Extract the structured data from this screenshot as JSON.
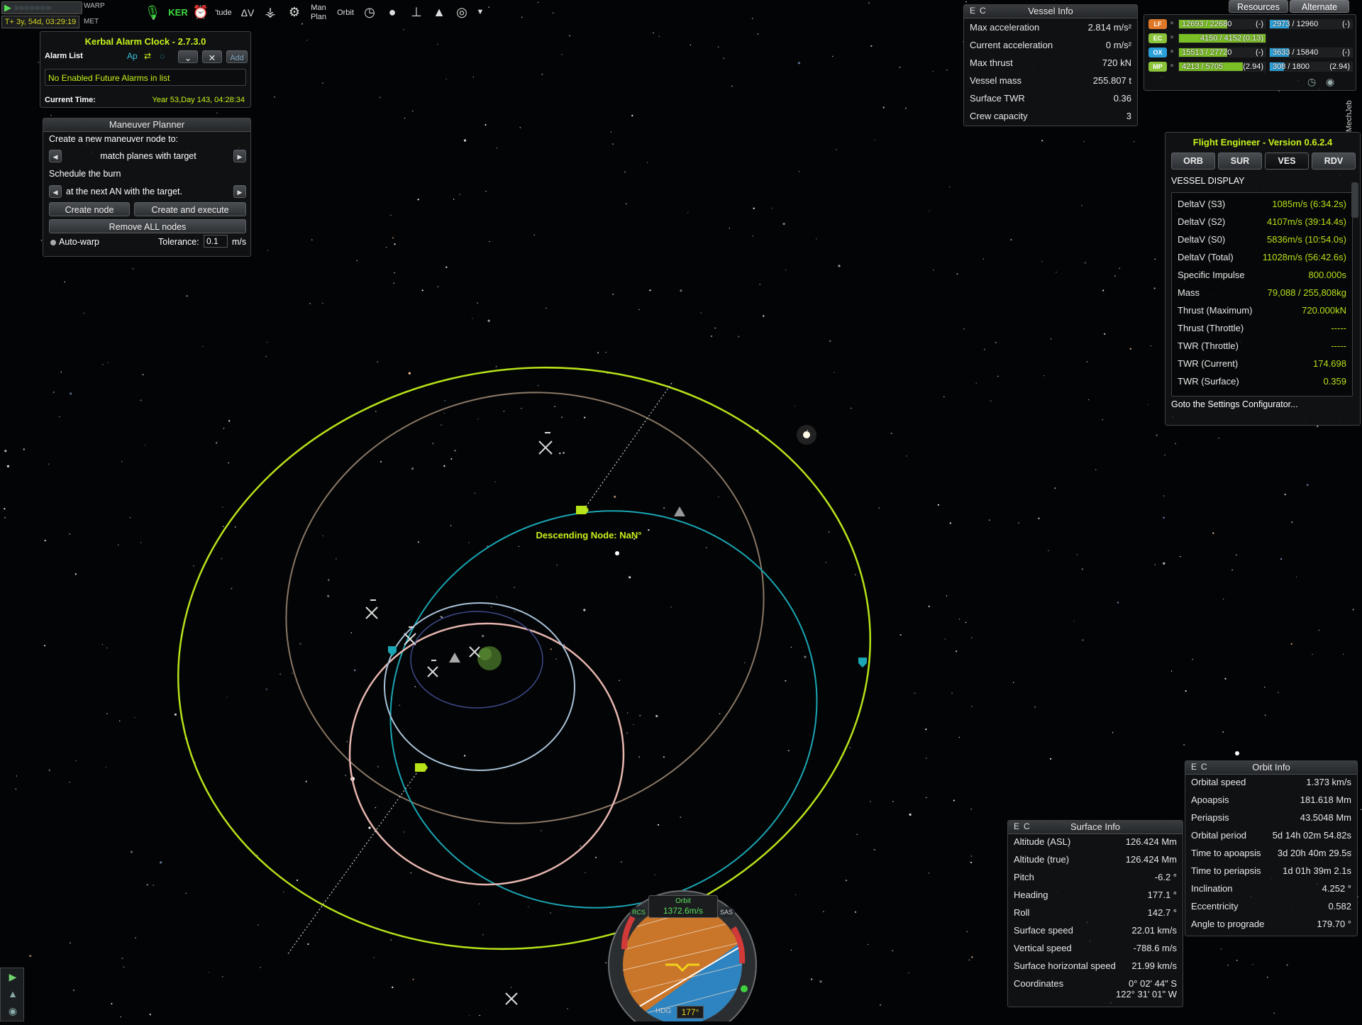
{
  "time": {
    "warp_label": "WARP",
    "met_time": "T+ 3y, 54d, 03:29:19",
    "met_label": "MET"
  },
  "toolbar": {
    "items": [
      {
        "label": "",
        "icon": "microphone-icon"
      },
      {
        "label": "KER",
        "icon": "ker-icon"
      },
      {
        "label": "",
        "icon": "alarm-clock-icon"
      },
      {
        "label": "'tude",
        "icon": "attitude-icon"
      },
      {
        "label": "ΔV",
        "icon": "delta-v-icon"
      },
      {
        "label": "",
        "icon": "lander-icon"
      },
      {
        "label": "",
        "icon": "settings-icon"
      },
      {
        "label": "Man\nPlan",
        "icon": "maneuver-planner-icon"
      },
      {
        "label": "Orbit",
        "icon": "orbit-icon"
      },
      {
        "label": "",
        "icon": "clock-icon"
      },
      {
        "label": "",
        "icon": "sphere-icon"
      },
      {
        "label": "",
        "icon": "antenna-icon"
      },
      {
        "label": "",
        "icon": "rocket-icon"
      },
      {
        "label": "",
        "icon": "target-icon"
      }
    ]
  },
  "alarm_clock": {
    "title": "Kerbal Alarm Clock - 2.7.3.0",
    "list_label": "Alarm List",
    "add_label": "Add",
    "empty_text": "No Enabled Future Alarms in list",
    "current_time_label": "Current Time:",
    "current_time": "Year 53,Day 143, 04:28:34"
  },
  "maneuver_planner": {
    "title": "Maneuver Planner",
    "create_label": "Create a new maneuver node to:",
    "operation": "match planes with target",
    "schedule_label": "Schedule the burn",
    "timing": "at the next AN with the target.",
    "create_node": "Create node",
    "create_execute": "Create and execute",
    "remove_all": "Remove ALL nodes",
    "autowarp": "Auto-warp",
    "tolerance_label": "Tolerance:",
    "tolerance_value": "0.1",
    "tolerance_unit": "m/s"
  },
  "vessel_info": {
    "title": "Vessel Info",
    "e": "E",
    "c": "C",
    "rows": [
      {
        "k": "Max acceleration",
        "v": "2.814 m/s²"
      },
      {
        "k": "Current acceleration",
        "v": "0 m/s²"
      },
      {
        "k": "Max thrust",
        "v": "720 kN"
      },
      {
        "k": "Vessel mass",
        "v": "255.807 t"
      },
      {
        "k": "Surface TWR",
        "v": "0.36"
      },
      {
        "k": "Crew capacity",
        "v": "3"
      }
    ]
  },
  "resources": {
    "tab1": "Resources",
    "tab2": "Alternate",
    "side_label": "MechJeb",
    "rows": [
      {
        "tag": "LF",
        "a": "12693 / 22680",
        "ar": "(-)",
        "b": "2973 / 12960",
        "br": "(-)",
        "af": 0.56,
        "bf": 0.23,
        "tagcolor": "#e0782a",
        "acolor": "#7bbf26",
        "bcolor": "#2a9fd8"
      },
      {
        "tag": "EC",
        "a": "4150 / 4152",
        "ar": "(0.13)",
        "b": "",
        "br": "",
        "af": 0.999,
        "bf": 0,
        "tagcolor": "#8bc43a",
        "acolor": "#7bbf26",
        "bcolor": "#2a9fd8"
      },
      {
        "tag": "OX",
        "a": "15513 / 27720",
        "ar": "(-)",
        "b": "3633 / 15840",
        "br": "(-)",
        "af": 0.56,
        "bf": 0.23,
        "tagcolor": "#2a9fd8",
        "acolor": "#7bbf26",
        "bcolor": "#2a9fd8"
      },
      {
        "tag": "MP",
        "a": "4213 / 5705",
        "ar": "(2.94)",
        "b": "308 / 1800",
        "br": "(2.94)",
        "af": 0.74,
        "bf": 0.17,
        "tagcolor": "#8bc43a",
        "acolor": "#7bbf26",
        "bcolor": "#2a9fd8"
      }
    ]
  },
  "flight_engineer": {
    "title": "Flight Engineer  -  Version 0.6.2.4",
    "tabs": [
      "ORB",
      "SUR",
      "VES",
      "RDV"
    ],
    "active_tab": "VES",
    "section": "VESSEL DISPLAY",
    "rows": [
      {
        "k": "DeltaV (S3)",
        "v": "1085m/s (6:34.2s)"
      },
      {
        "k": "DeltaV (S2)",
        "v": "4107m/s (39:14.4s)"
      },
      {
        "k": "DeltaV (S0)",
        "v": "5836m/s (10:54.0s)"
      },
      {
        "k": "DeltaV (Total)",
        "v": "11028m/s (56:42.6s)"
      },
      {
        "k": "Specific Impulse",
        "v": "800.000s"
      },
      {
        "k": "Mass",
        "v": "79,088 / 255,808kg"
      },
      {
        "k": "Thrust (Maximum)",
        "v": "720.000kN"
      },
      {
        "k": "Thrust (Throttle)",
        "v": "-----"
      },
      {
        "k": "TWR (Throttle)",
        "v": "-----"
      },
      {
        "k": "TWR (Current)",
        "v": "174.698"
      },
      {
        "k": "TWR (Surface)",
        "v": "0.359"
      }
    ],
    "settings_link": "Goto the Settings Configurator..."
  },
  "map": {
    "descending_node": "Descending Node: NaN°"
  },
  "surface_info": {
    "title": "Surface Info",
    "e": "E",
    "c": "C",
    "rows": [
      {
        "k": "Altitude (ASL)",
        "v": "126.424 Mm"
      },
      {
        "k": "Altitude (true)",
        "v": "126.424 Mm"
      },
      {
        "k": "Pitch",
        "v": "-6.2 °"
      },
      {
        "k": "Heading",
        "v": "177.1 °"
      },
      {
        "k": "Roll",
        "v": "142.7 °"
      },
      {
        "k": "Surface speed",
        "v": "22.01 km/s"
      },
      {
        "k": "Vertical speed",
        "v": "-788.6 m/s"
      },
      {
        "k": "Surface horizontal speed",
        "v": "21.99 km/s"
      }
    ],
    "coord_label": "Coordinates",
    "coord_lat": "0° 02' 44\" S",
    "coord_lon": "122° 31' 01\" W"
  },
  "orbit_info": {
    "title": "Orbit Info",
    "e": "E",
    "c": "C",
    "rows": [
      {
        "k": "Orbital speed",
        "v": "1.373 km/s"
      },
      {
        "k": "Apoapsis",
        "v": "181.618 Mm"
      },
      {
        "k": "Periapsis",
        "v": "43.5048 Mm"
      },
      {
        "k": "Orbital period",
        "v": "5d 14h 02m 54.82s"
      },
      {
        "k": "Time to apoapsis",
        "v": "3d 20h 40m 29.5s"
      },
      {
        "k": "Time to periapsis",
        "v": "1d 01h 39m 2.1s"
      },
      {
        "k": "Inclination",
        "v": "4.252 °"
      },
      {
        "k": "Eccentricity",
        "v": "0.582"
      },
      {
        "k": "Angle to prograde",
        "v": "179.70 °"
      }
    ]
  },
  "navball": {
    "mode": "Orbit",
    "speed": "1372.6m/s",
    "rcs": "RCS",
    "sas": "SAS",
    "hdg_label": "HDG",
    "heading": "177°"
  },
  "colors": {
    "orbit_green": "#b8e21a",
    "orbit_cyan": "#1aa6b4",
    "orbit_brown": "#8a7765",
    "orbit_pink": "#e7b6b0",
    "orbit_blue": "#a9c2d9",
    "orbit_dark": "#3d4a8a",
    "accent_yellow": "#c7f21c"
  }
}
